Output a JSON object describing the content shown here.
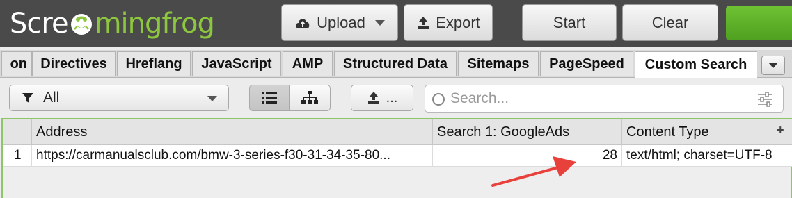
{
  "header": {
    "logo_part1": "Scre",
    "logo_part2": "mingfrog",
    "buttons": {
      "upload": "Upload",
      "export": "Export",
      "start": "Start",
      "clear": "Clear"
    }
  },
  "tabs": [
    {
      "label": "on"
    },
    {
      "label": "Directives"
    },
    {
      "label": "Hreflang"
    },
    {
      "label": "JavaScript"
    },
    {
      "label": "AMP"
    },
    {
      "label": "Structured Data"
    },
    {
      "label": "Sitemaps"
    },
    {
      "label": "PageSpeed"
    },
    {
      "label": "Custom Search",
      "active": true
    }
  ],
  "toolbar": {
    "filter_value": "All",
    "export_label": "...",
    "search_placeholder": "Search..."
  },
  "table": {
    "columns": [
      "",
      "Address",
      "Search 1: GoogleAds",
      "Content Type"
    ],
    "rows": [
      {
        "index": "1",
        "address": "https://carmanualsclub.com/bmw-3-series-f30-31-34-35-80...",
        "count": "28",
        "content_type": "text/html; charset=UTF-8"
      }
    ]
  },
  "colors": {
    "brand_green": "#8dc63f",
    "header_bg": "#4a4a4a",
    "arrow": "#e8413c"
  }
}
